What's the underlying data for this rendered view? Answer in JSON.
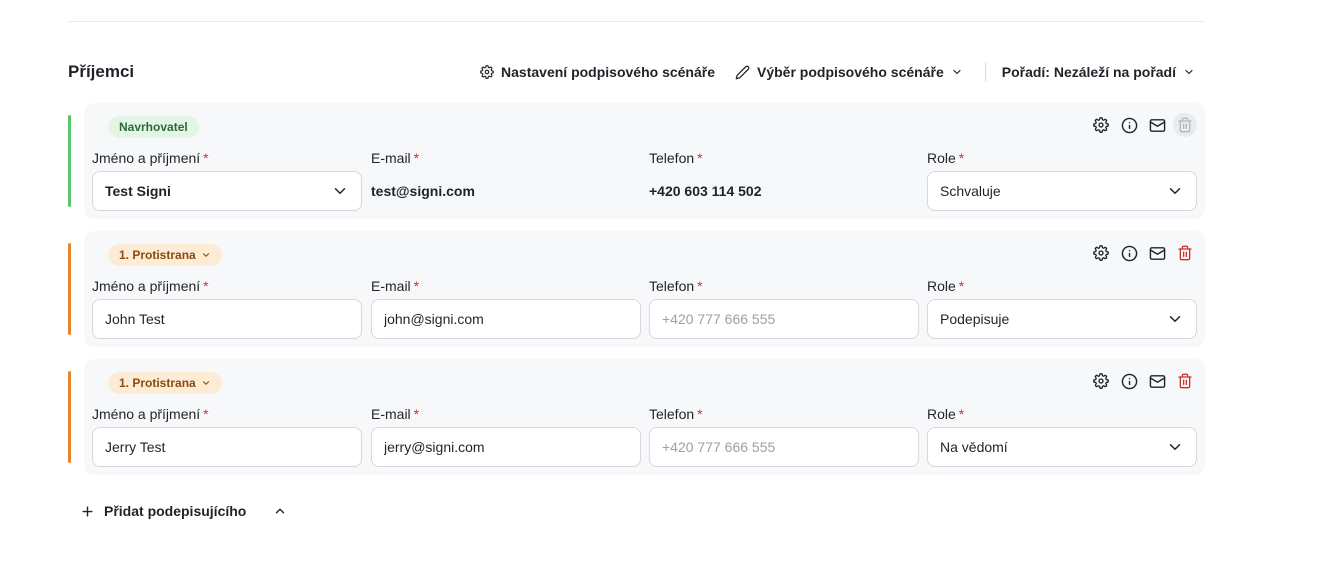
{
  "header": {
    "title": "Příjemci",
    "settings_label": "Nastavení podpisového scénáře",
    "scenario_label": "Výběr podpisového scénáře",
    "order_label": "Pořadí: Nezáleží na pořadí"
  },
  "fields": {
    "name_label": "Jméno a příjmení",
    "email_label": "E-mail",
    "phone_label": "Telefon",
    "role_label": "Role",
    "required_mark": "*",
    "phone_placeholder": "+420 777 666 555"
  },
  "recipients": [
    {
      "badge": "Navrhovatel",
      "name": "Test Signi",
      "email": "test@signi.com",
      "phone": "+420 603 114 502",
      "role": "Schvaluje"
    },
    {
      "badge": "1. Protistrana",
      "name": "John Test",
      "email": "john@signi.com",
      "phone": "",
      "role": "Podepisuje"
    },
    {
      "badge": "1. Protistrana",
      "name": "Jerry Test",
      "email": "jerry@signi.com",
      "phone": "",
      "role": "Na vědomí"
    }
  ],
  "footer": {
    "add_label": "Přidat podepisujícího"
  },
  "colors": {
    "accent_green": "#5cc46a",
    "accent_orange": "#e7852a",
    "delete_red": "#d0302f",
    "required_red": "#d0302f"
  }
}
